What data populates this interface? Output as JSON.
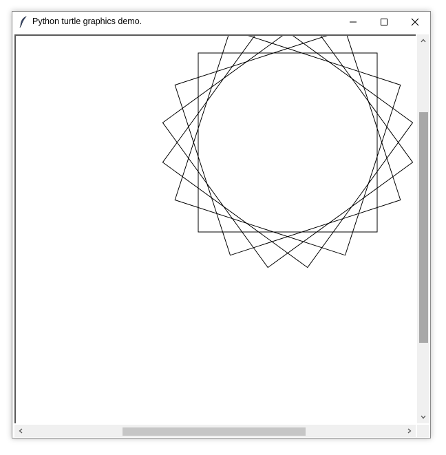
{
  "window": {
    "title": "Python turtle graphics demo.",
    "icons": {
      "app": "feather-icon",
      "minimize": "minimize-icon",
      "maximize": "maximize-icon",
      "close": "close-icon"
    }
  },
  "canvas": {
    "drawing": "turtle-spirograph-squares",
    "stroke_color": "#000000",
    "background_color": "#ffffff"
  },
  "scrollbars": {
    "vertical": {
      "up_icon": "chevron-up-icon",
      "down_icon": "chevron-down-icon"
    },
    "horizontal": {
      "left_icon": "chevron-left-icon",
      "right_icon": "chevron-right-icon"
    }
  }
}
